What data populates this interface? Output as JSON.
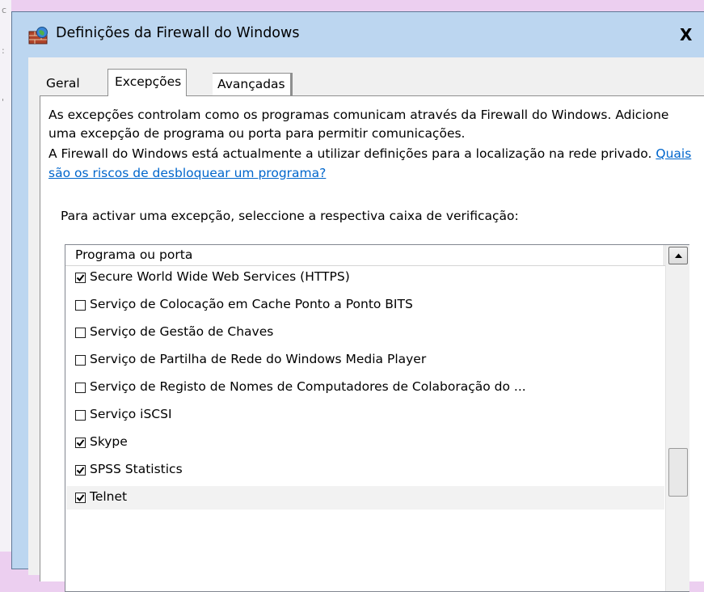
{
  "window": {
    "title": "Definições da Firewall do Windows",
    "close_label": "X"
  },
  "tabs": [
    {
      "label": "Geral",
      "active": false
    },
    {
      "label": "Excepções",
      "active": true
    },
    {
      "label": "Avançadas",
      "active": false
    }
  ],
  "description": "As excepções controlam como os programas comunicam através da Firewall do Windows. Adicione uma excepção de programa ou porta para permitir comunicações.",
  "location_text": "A Firewall do Windows está actualmente a utilizar definições para a localização na rede privado.",
  "risk_link": "Quais são os riscos de desbloquear um programa?",
  "instruction": "Para activar uma excepção, seleccione a respectiva caixa de verificação:",
  "list": {
    "column_header": "Programa ou porta",
    "items": [
      {
        "label": "Secure World Wide Web Services (HTTPS)",
        "checked": true
      },
      {
        "label": "Serviço de Colocação em Cache Ponto a Ponto BITS",
        "checked": false
      },
      {
        "label": "Serviço de Gestão de Chaves",
        "checked": false
      },
      {
        "label": "Serviço de Partilha de Rede do Windows Media Player",
        "checked": false
      },
      {
        "label": "Serviço de Registo de Nomes de Computadores de Colaboração do ...",
        "checked": false
      },
      {
        "label": "Serviço iSCSI",
        "checked": false
      },
      {
        "label": "Skype",
        "checked": true
      },
      {
        "label": "SPSS Statistics",
        "checked": true
      },
      {
        "label": "Telnet",
        "checked": true
      }
    ]
  },
  "colors": {
    "desktop_bg": "#eccff0",
    "title_bar": "#bcd6f0",
    "link": "#0066cc"
  },
  "icons": {
    "title_icon": "firewall-icon",
    "scroll_up": "arrow-up-icon",
    "check": "checkmark-icon"
  }
}
